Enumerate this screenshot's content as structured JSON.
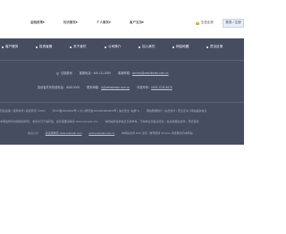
{
  "header": {
    "nav": [
      {
        "label": "金融政策"
      },
      {
        "label": "知识服务"
      },
      {
        "label": "个人服务"
      },
      {
        "label": "客户支持"
      }
    ],
    "user_label": "王总业务",
    "login_label": "登录 / 注册"
  },
  "footer": {
    "links": [
      {
        "label": "客户服务"
      },
      {
        "label": "投资者服"
      },
      {
        "label": "关于我们"
      },
      {
        "label": "公司简介"
      },
      {
        "label": "加入我们"
      },
      {
        "label": "网站地图"
      },
      {
        "label": "意见反馈"
      }
    ],
    "contact1": {
      "location": "总部基地",
      "phone_label": "客服电话：",
      "phone": "400-111-0000",
      "email_label": "客服邮箱：",
      "email": "service@websiteabc.com.cn"
    },
    "contact2": {
      "a_label": "投资者关系热线电话：",
      "a_value": "4008-0000",
      "b_label": "联系邮箱：",
      "b_value": "ir@websiteabc.com.cn",
      "c_label": "传真号码：",
      "c_value": "0000-1234-5678"
    },
    "legal": {
      "line1_a": "隐私政策 | 使用条款 | 版权所有 ©2023",
      "line1_b": "沪ICP备00000000号-1 沪公网安备31000000000000号 | 信息安全 (站群 1)",
      "line1_c": "网站数据统计 | 站长统计 | 安全证书 | 网站备案信息",
      "line2_a": "本网站所有内容版权所有，未经许可不得转载，如有需要请联系 www.example.com",
      "line2_b": "本网站所提供信息仅供参考，不构成任何投资建议，投资者据此操作，风险自担",
      "line3_a": "信息公示",
      "line3_b": "投资者教育 www.example.com",
      "line3_c": "www.example.com.cn",
      "line3_d": "本网站支持 IPv6 访问 · 推荐使用 Chrome 浏览器访问本网站"
    }
  }
}
